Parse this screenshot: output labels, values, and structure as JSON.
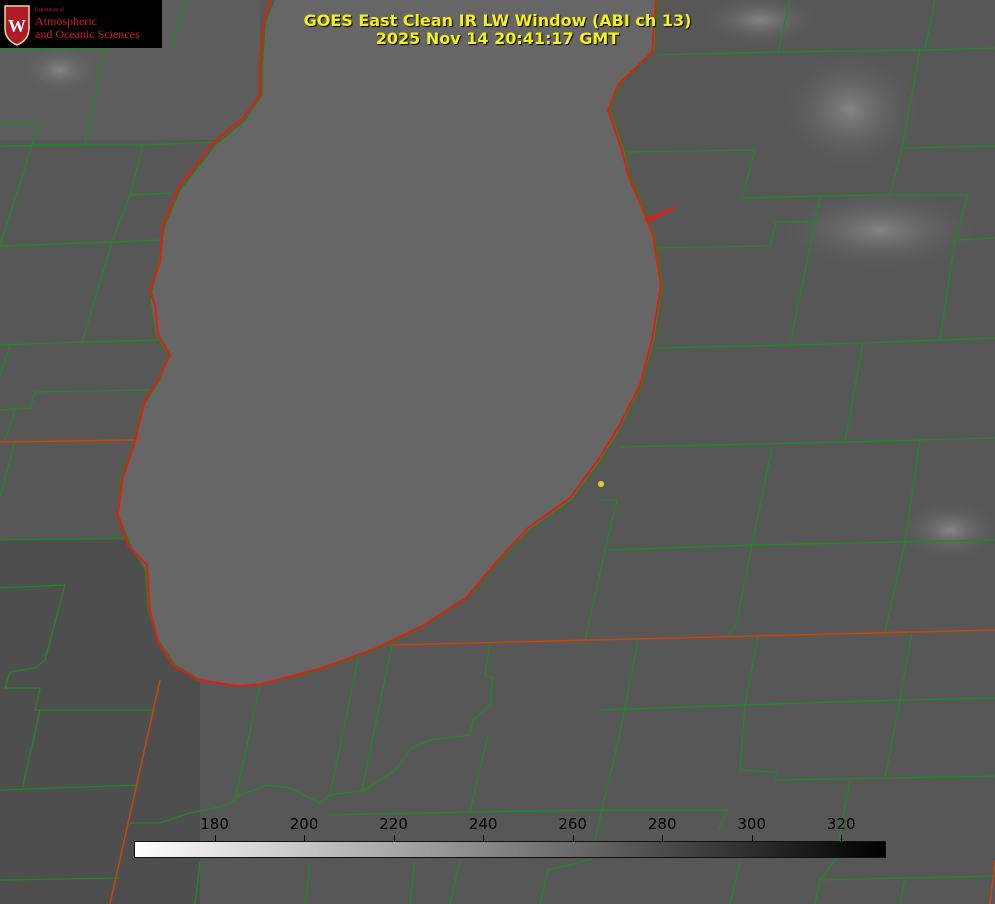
{
  "title": {
    "line1": "GOES East Clean IR LW Window (ABI ch 13)",
    "line2": "2025 Nov 14 20:41:17 GMT"
  },
  "logo": {
    "dept": "Department of",
    "line1": "Atmospheric",
    "line2": "and Oceanic Sciences",
    "seal_letter": "W"
  },
  "colorbar": {
    "ticks": [
      "180",
      "200",
      "220",
      "240",
      "260",
      "280",
      "300",
      "320"
    ],
    "min": 162,
    "max": 330,
    "gradient": "white-to-black"
  },
  "colors": {
    "title": "#f5ef1a",
    "county_lines": "#1f8a1f",
    "coast_line": "#e11d12",
    "state_lines": "#d0480e",
    "station_marker": "#e0d020"
  }
}
